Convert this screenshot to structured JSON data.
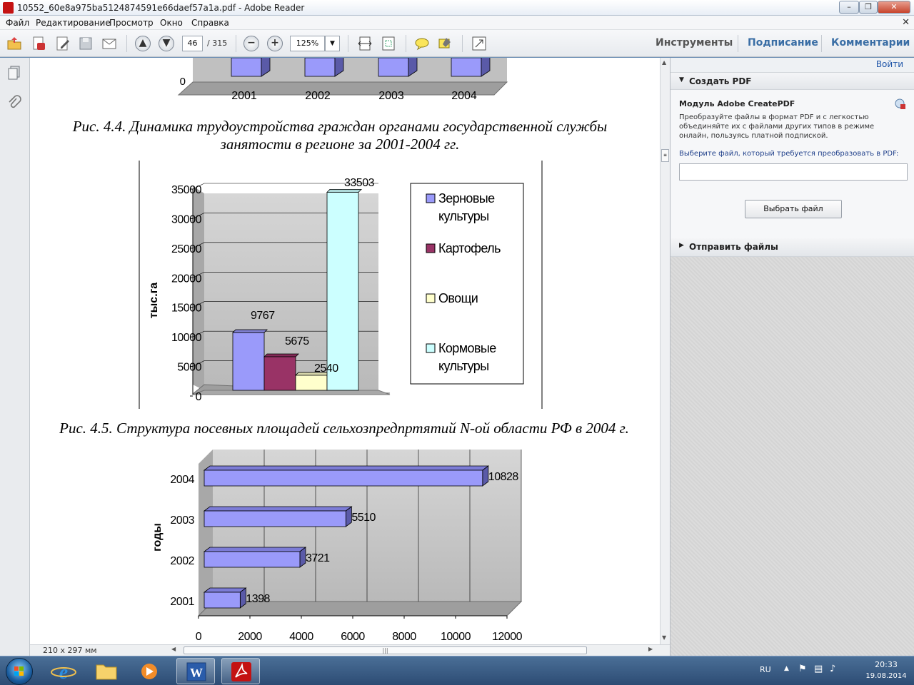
{
  "window": {
    "title": "10552_60e8a975ba5124874591e66daef57a1a.pdf - Adobe Reader"
  },
  "menu": [
    "Файл",
    "Редактирование",
    "Просмотр",
    "Окно",
    "Справка"
  ],
  "toolbar": {
    "page_current": "46",
    "page_total": "/ 315",
    "zoom": "125%",
    "links": [
      "Инструменты",
      "Подписание",
      "Комментарии"
    ]
  },
  "document": {
    "caption_4_4_line1": "Рис. 4.4. Динамика трудоустройства граждан органами государственной службы",
    "caption_4_4_line2": "занятости в регионе за 2001-2004 гг.",
    "caption_4_5": "Рис. 4.5. Структура посевных площадей сельхозпредпртятий N-ой области РФ в 2004 г.",
    "page_size": "210 x 297 мм"
  },
  "chart_data": [
    {
      "type": "bar",
      "categories": [
        "2001",
        "2002",
        "2003",
        "2004"
      ],
      "values": [],
      "title": "",
      "ylabel": "",
      "partial": true
    },
    {
      "type": "bar",
      "title": "",
      "ylabel": "тыс.га",
      "ylim": [
        0,
        35000
      ],
      "yticks": [
        "0",
        "5000",
        "10000",
        "15000",
        "20000",
        "25000",
        "30000",
        "35000"
      ],
      "legend_position": "right",
      "series": [
        {
          "name": "Зерновые культуры",
          "value": 9767,
          "label": "9767",
          "color": "#9a9afa"
        },
        {
          "name": "Картофель",
          "value": 5675,
          "label": "5675",
          "color": "#993366"
        },
        {
          "name": "Овощи",
          "value": 2540,
          "label": "2540",
          "color": "#ffffcc"
        },
        {
          "name": "Кормовые культуры",
          "value": 33503,
          "label": "33503",
          "color": "#ccffff"
        }
      ],
      "legend": [
        {
          "line1": "Зерновые",
          "line2": "культуры",
          "color": "#9a9afa"
        },
        {
          "line1": "Картофель",
          "line2": "",
          "color": "#993366"
        },
        {
          "line1": "Овощи",
          "line2": "",
          "color": "#ffffcc"
        },
        {
          "line1": "Кормовые",
          "line2": "культуры",
          "color": "#ccffff"
        }
      ]
    },
    {
      "type": "bar",
      "orientation": "horizontal",
      "title": "",
      "ylabel": "годы",
      "xlim": [
        0,
        12000
      ],
      "xticks": [
        "0",
        "2000",
        "4000",
        "6000",
        "8000",
        "10000",
        "12000"
      ],
      "categories": [
        "2004",
        "2003",
        "2002",
        "2001"
      ],
      "values": [
        10828,
        5510,
        3721,
        1398
      ],
      "labels": [
        "10828",
        "5510",
        "3721",
        "1398"
      ],
      "color": "#9a9afa"
    }
  ],
  "right_pane": {
    "top_link": "Войти",
    "create_pdf": "Создать PDF",
    "module_title": "Модуль Adobe CreatePDF",
    "module_desc": "Преобразуйте файлы в формат PDF и с легкостью объединяйте их с файлами других типов в режиме онлайн, пользуясь платной подпиской.",
    "select_label": "Выберите файл, который требуется преобразовать в PDF:",
    "choose_button": "Выбрать файл",
    "send_files": "Отправить файлы"
  },
  "taskbar": {
    "lang": "RU",
    "time": "20:33",
    "date": "19.08.2014"
  },
  "colors": {
    "link_blue": "#3a6ea5",
    "chart_wall": "#c0c0c0",
    "bar_blue": "#9a9afa"
  }
}
